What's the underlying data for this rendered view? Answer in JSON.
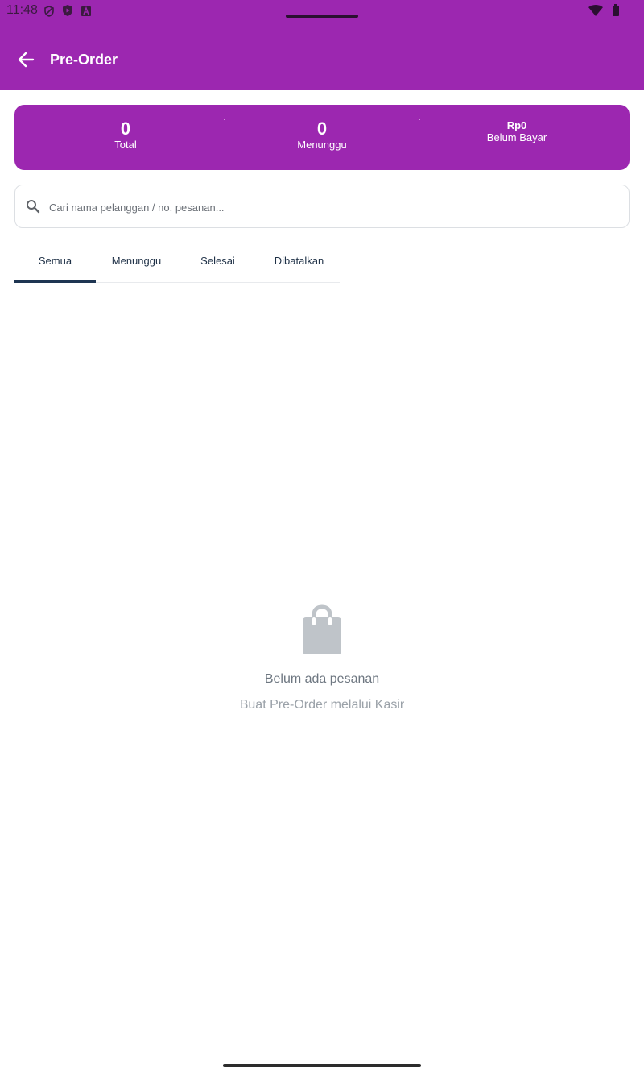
{
  "status_bar": {
    "time": "11:48",
    "icons_left": [
      "privacy-shield-icon",
      "play-protect-icon",
      "font-a-icon"
    ],
    "icons_right": [
      "wifi-icon",
      "battery-icon"
    ]
  },
  "header": {
    "title": "Pre-Order",
    "back_icon": "arrow-back-icon"
  },
  "summary": {
    "total_value": "0",
    "total_label": "Total",
    "waiting_value": "0",
    "waiting_label": "Menunggu",
    "unpaid_value": "Rp0",
    "unpaid_label": "Belum Bayar"
  },
  "search": {
    "placeholder": "Cari nama pelanggan / no. pesanan...",
    "value": ""
  },
  "tabs": [
    {
      "label": "Semua",
      "active": true
    },
    {
      "label": "Menunggu",
      "active": false
    },
    {
      "label": "Selesai",
      "active": false
    },
    {
      "label": "Dibatalkan",
      "active": false
    }
  ],
  "empty_state": {
    "icon": "shopping-bag-icon",
    "title": "Belum ada pesanan",
    "subtitle": "Buat Pre-Order melalui Kasir"
  },
  "colors": {
    "primary": "#9c27b0",
    "tab_text": "#1f3147",
    "empty_icon": "#bfc4c9"
  }
}
